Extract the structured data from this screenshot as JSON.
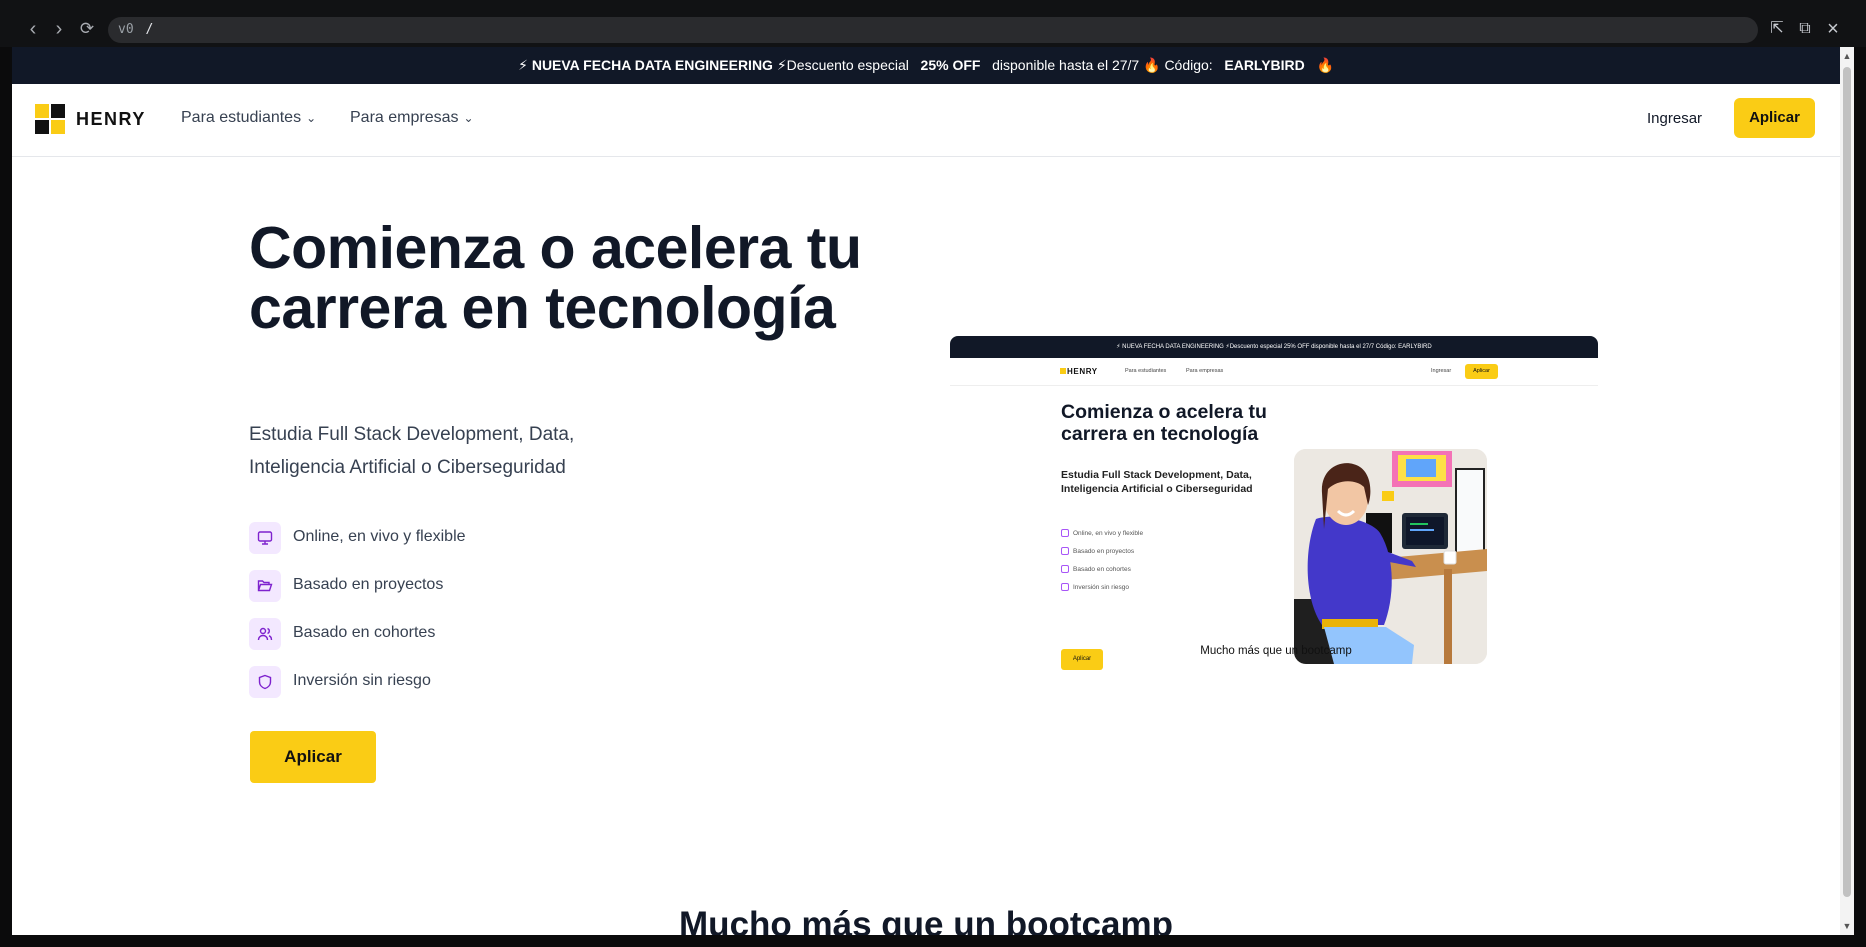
{
  "browser": {
    "url_prefix": "v0",
    "url": "/"
  },
  "promo": {
    "lead": "⚡ NUEVA FECHA DATA ENGINEERING",
    "middle": "⚡Descuento especial",
    "discount": "25% OFF",
    "until": "disponible hasta el 27/7",
    "code_label": "Código:",
    "code": "EARLYBIRD"
  },
  "nav": {
    "brand": "HENRY",
    "menu_students": "Para estudiantes",
    "menu_companies": "Para empresas",
    "login": "Ingresar",
    "apply": "Aplicar"
  },
  "hero": {
    "title": "Comienza o acelera tu carrera en tecnología",
    "subtitle": "Estudia Full Stack Development, Data, Inteligencia Artificial o Ciberseguridad",
    "features": [
      {
        "icon": "monitor-icon",
        "label": "Online, en vivo y flexible"
      },
      {
        "icon": "folder-icon",
        "label": "Basado en proyectos"
      },
      {
        "icon": "users-icon",
        "label": "Basado en cohortes"
      },
      {
        "icon": "shield-icon",
        "label": "Inversión sin riesgo"
      }
    ],
    "apply": "Aplicar"
  },
  "preview": {
    "bar_text": "⚡ NUEVA FECHA DATA ENGINEERING ⚡Descuento especial  25% OFF  disponible hasta el 27/7  Código:  EARLYBIRD",
    "brand": "HENRY",
    "menu_students": "Para estudiantes",
    "menu_companies": "Para empresas",
    "login": "Ingresar",
    "apply": "Aplicar",
    "title": "Comienza o acelera tu carrera en tecnología",
    "subtitle": "Estudia Full Stack Development, Data, Inteligencia Artificial o Ciberseguridad",
    "features": [
      "Online, en vivo y flexible",
      "Basado en proyectos",
      "Basado en cohortes",
      "Inversión sin riesgo"
    ],
    "button": "Aplicar",
    "caption": "Mucho más que un bootcamp"
  },
  "next_section": {
    "title": "Mucho más que un bootcamp"
  },
  "colors": {
    "accent": "#facc15",
    "dark": "#111827",
    "icon_bg": "#f3e8ff",
    "icon_fg": "#7e22ce"
  }
}
